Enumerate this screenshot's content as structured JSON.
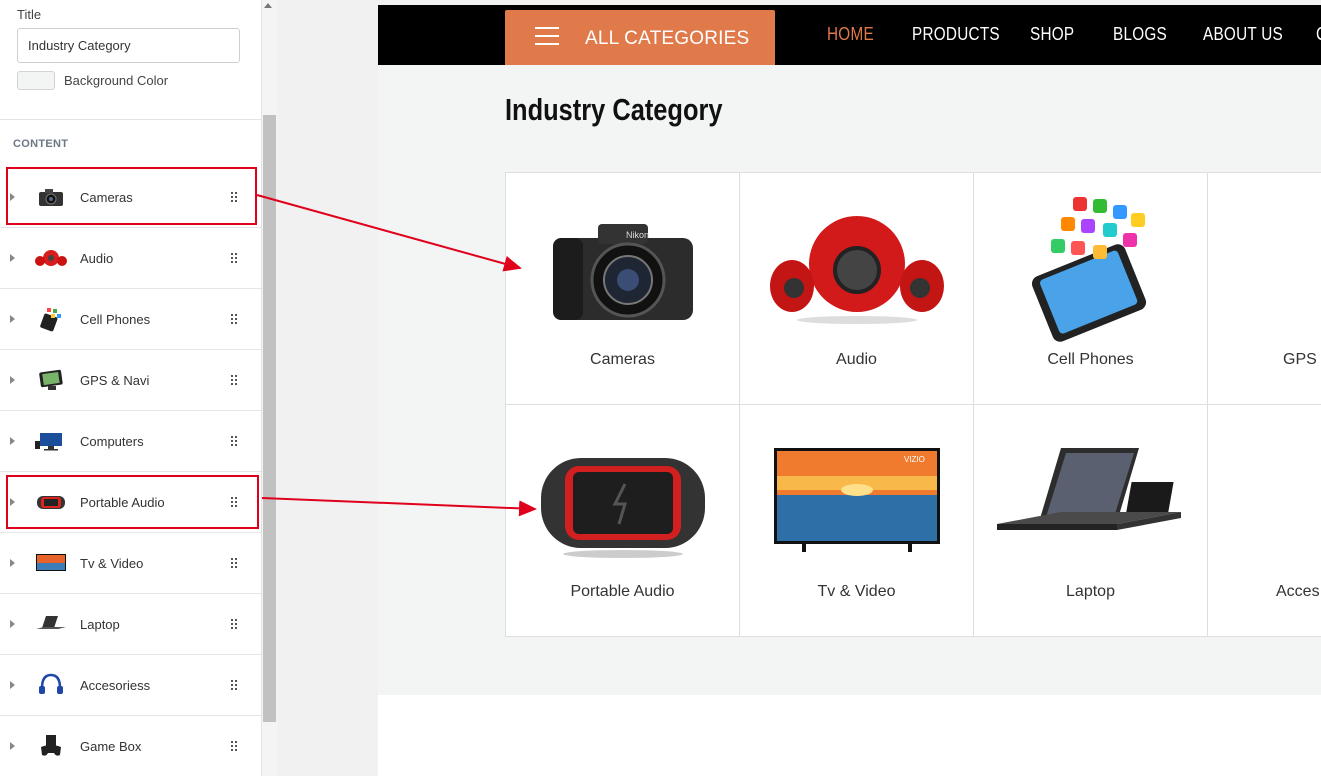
{
  "panel": {
    "title_label": "Title",
    "title_value": "Industry Category",
    "bg_label": "Background Color",
    "content_label": "CONTENT",
    "items": [
      {
        "label": "Cameras"
      },
      {
        "label": "Audio"
      },
      {
        "label": "Cell Phones"
      },
      {
        "label": "GPS & Navi"
      },
      {
        "label": "Computers"
      },
      {
        "label": "Portable Audio"
      },
      {
        "label": "Tv & Video"
      },
      {
        "label": "Laptop"
      },
      {
        "label": "Accesoriess"
      },
      {
        "label": "Game Box"
      }
    ]
  },
  "nav": {
    "categories_label": "ALL CATEGORIES",
    "items": [
      "HOME",
      "PRODUCTS",
      "SHOP",
      "BLOGS",
      "ABOUT US"
    ]
  },
  "preview": {
    "heading": "Industry Category",
    "cards": [
      {
        "name": "Cameras"
      },
      {
        "name": "Audio"
      },
      {
        "name": "Cell Phones"
      },
      {
        "name": "GPS &"
      },
      {
        "name": "Portable Audio"
      },
      {
        "name": "Tv & Video"
      },
      {
        "name": "Laptop"
      },
      {
        "name": "Acces"
      }
    ]
  },
  "colors": {
    "accent": "#e07a4b",
    "highlight": "#e0001b",
    "nav_bg": "#000000"
  }
}
